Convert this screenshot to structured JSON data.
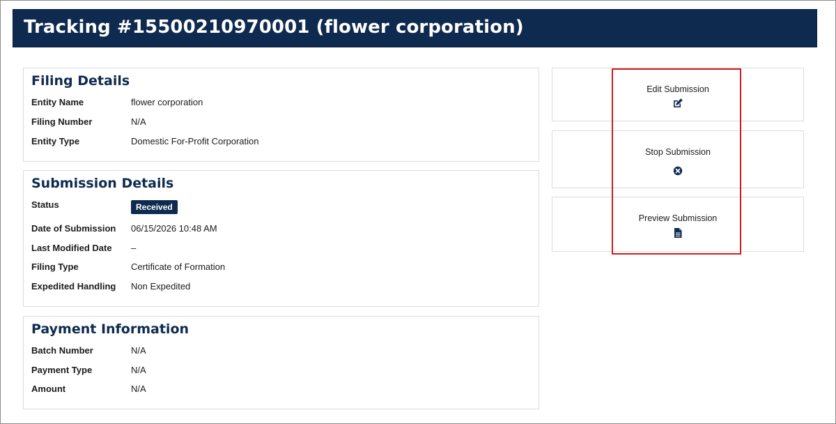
{
  "header": {
    "title": "Tracking #15500210970001 (flower corporation)"
  },
  "filing_details": {
    "title": "Filing Details",
    "rows": [
      {
        "label": "Entity Name",
        "value": "flower corporation"
      },
      {
        "label": "Filing Number",
        "value": "N/A"
      },
      {
        "label": "Entity Type",
        "value": "Domestic For-Profit Corporation"
      }
    ]
  },
  "submission_details": {
    "title": "Submission Details",
    "status_label": "Status",
    "status_value": "Received",
    "rows": [
      {
        "label": "Date of Submission",
        "value": "06/15/2026 10:48 AM"
      },
      {
        "label": "Last Modified Date",
        "value": "–"
      },
      {
        "label": "Filing Type",
        "value": "Certificate of Formation"
      },
      {
        "label": "Expedited Handling",
        "value": "Non Expedited"
      }
    ]
  },
  "payment_information": {
    "title": "Payment Information",
    "rows": [
      {
        "label": "Batch Number",
        "value": "N/A"
      },
      {
        "label": "Payment Type",
        "value": "N/A"
      },
      {
        "label": "Amount",
        "value": "N/A"
      }
    ]
  },
  "actions": [
    {
      "label": "Edit Submission",
      "icon": "edit-icon"
    },
    {
      "label": "Stop Submission",
      "icon": "close-circle-icon"
    },
    {
      "label": "Preview Submission",
      "icon": "document-icon"
    }
  ],
  "colors": {
    "header_bg": "#0e2a4f",
    "heading_text": "#0e2a4f",
    "badge_bg": "#0e2a4f",
    "highlight_border": "#d0191c"
  }
}
